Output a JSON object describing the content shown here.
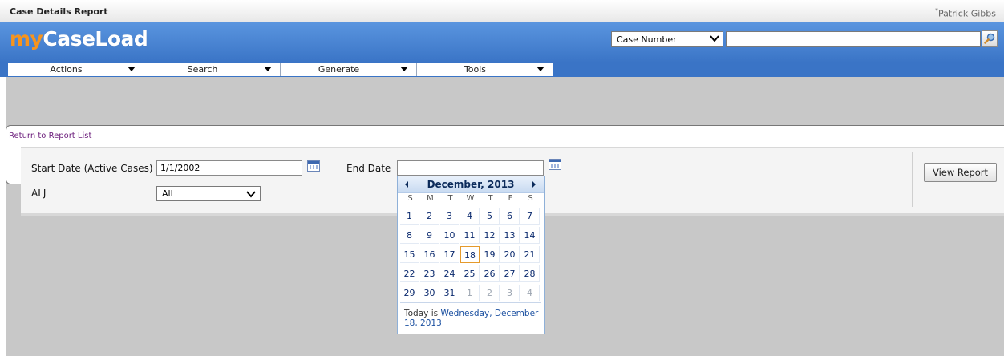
{
  "window": {
    "title": "Case Details Report",
    "user_mark": "*",
    "user": "Patrick Gibbs"
  },
  "logo": {
    "part1": "my",
    "part2": "CaseLoad"
  },
  "search": {
    "type_value": "Case Number",
    "input_value": "",
    "button_icon": "magnifier-icon"
  },
  "menu": [
    {
      "label": "Actions"
    },
    {
      "label": "Search"
    },
    {
      "label": "Generate"
    },
    {
      "label": "Tools"
    }
  ],
  "report": {
    "return_link": "Return to Report List",
    "start_date_label": "Start Date (Active Cases)",
    "start_date_value": "1/1/2002",
    "end_date_label": "End Date",
    "end_date_value": "",
    "alj_label": "ALJ",
    "alj_value": "All",
    "view_button": "View Report"
  },
  "calendar": {
    "month_label": "December, 2013",
    "weekdays": [
      "S",
      "M",
      "T",
      "W",
      "T",
      "F",
      "S"
    ],
    "weeks": [
      [
        "1",
        "2",
        "3",
        "4",
        "5",
        "6",
        "7"
      ],
      [
        "8",
        "9",
        "10",
        "11",
        "12",
        "13",
        "14"
      ],
      [
        "15",
        "16",
        "17",
        "18",
        "19",
        "20",
        "21"
      ],
      [
        "22",
        "23",
        "24",
        "25",
        "26",
        "27",
        "28"
      ],
      [
        "29",
        "30",
        "31",
        "1",
        "2",
        "3",
        "4"
      ]
    ],
    "other_month_cells": [
      [
        4,
        3
      ],
      [
        4,
        4
      ],
      [
        4,
        5
      ],
      [
        4,
        6
      ]
    ],
    "selected_cell": [
      2,
      3
    ],
    "today_prefix": "Today is ",
    "today_text": "Wednesday, December 18, 2013"
  },
  "colors": {
    "header_blue": "#3a74c6",
    "logo_orange": "#f7941d",
    "link_purple": "#6a1b7a"
  }
}
